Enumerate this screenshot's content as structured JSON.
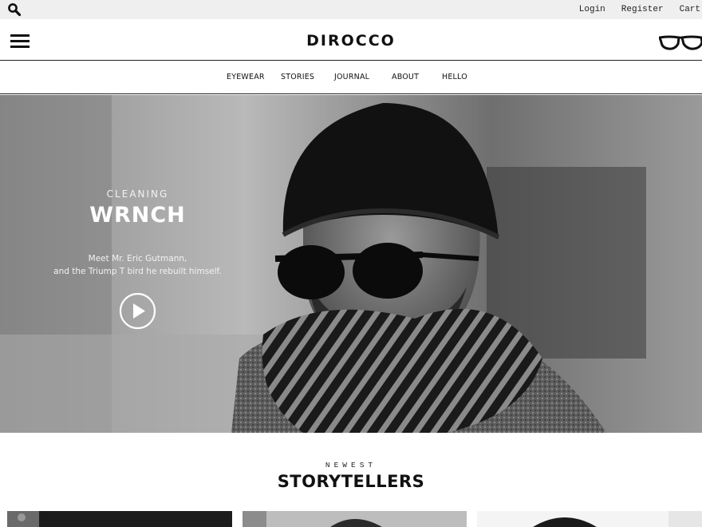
{
  "utility": {
    "search_icon": "search-icon",
    "links": [
      "Login",
      "Register",
      "Cart"
    ]
  },
  "header": {
    "logo": "DIROCCO",
    "menu_icon": "hamburger-menu-icon",
    "glasses_icon": "glasses-icon"
  },
  "nav": {
    "items": [
      "EYEWEAR",
      "STORIES",
      "JOURNAL",
      "ABOUT",
      "HELLO"
    ]
  },
  "hero": {
    "kicker": "CLEANING",
    "title": "WRNCH",
    "description_line1": "Meet Mr. Eric Gutmann,",
    "description_line2": "and the Triump T bird he rebuilt himself.",
    "play_icon": "play-icon"
  },
  "storytellers": {
    "kicker": "NEWEST",
    "title": "STORYTELLERS"
  },
  "colors": {
    "utility_bar": "#efefef",
    "text": "#111111",
    "hero_text": "#ffffff"
  }
}
